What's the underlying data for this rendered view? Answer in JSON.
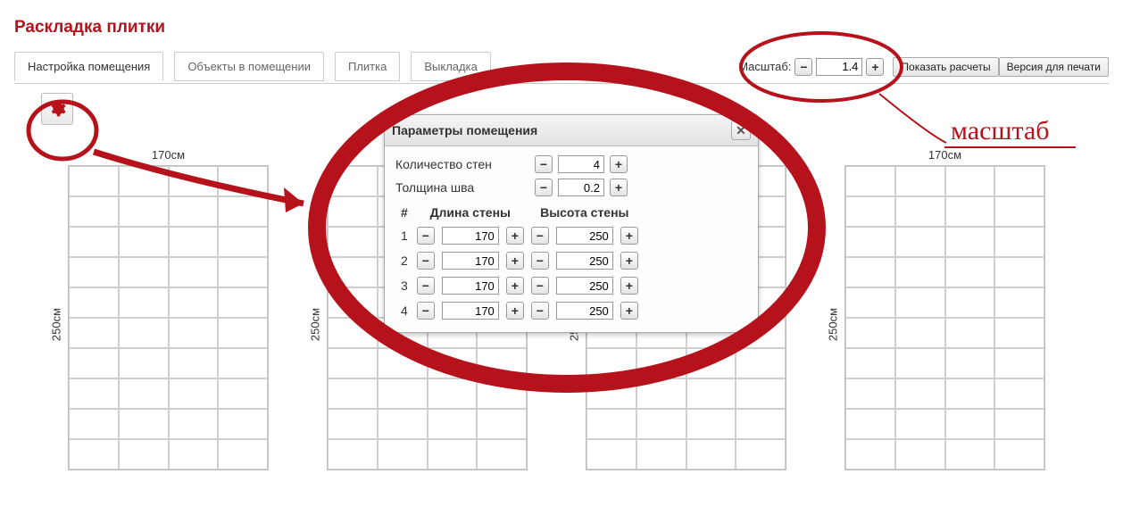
{
  "title": "Раскладка плитки",
  "tabs": [
    "Настройка помещения",
    "Объекты в помещении",
    "Плитка",
    "Выкладка"
  ],
  "scale": {
    "label": "Масштаб:",
    "value": "1.4"
  },
  "buttons": {
    "show_calc": "Показать расчеты",
    "print_version": "Версия для печати"
  },
  "walls": {
    "top": "170см",
    "left": "250см"
  },
  "popup": {
    "title": "Параметры помещения",
    "count_label": "Количество стен",
    "count_value": "4",
    "seam_label": "Толщина шва",
    "seam_value": "0.2",
    "headers": {
      "num": "#",
      "len": "Длина стены",
      "hgt": "Высота стены"
    },
    "rows": [
      {
        "n": "1",
        "len": "170",
        "hgt": "250"
      },
      {
        "n": "2",
        "len": "170",
        "hgt": "250"
      },
      {
        "n": "3",
        "len": "170",
        "hgt": "250"
      },
      {
        "n": "4",
        "len": "170",
        "hgt": "250"
      }
    ]
  },
  "annotation": "масштаб"
}
